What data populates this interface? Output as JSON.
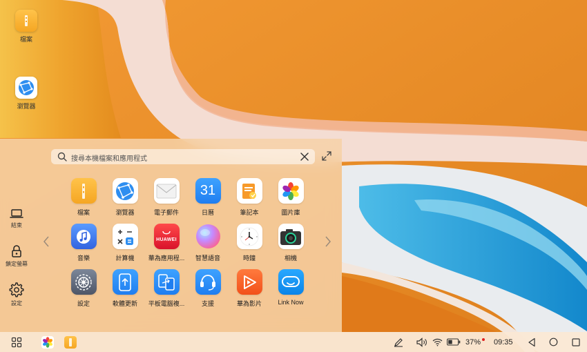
{
  "desktop": {
    "icons": [
      {
        "label": "檔案",
        "icon": "files-icon"
      },
      {
        "label": "瀏覽器",
        "icon": "browser-icon"
      }
    ]
  },
  "launcher": {
    "search": {
      "placeholder": "搜尋本機檔案和應用程式"
    },
    "side": [
      {
        "label": "結束",
        "icon": "laptop-icon"
      },
      {
        "label": "鎖定螢幕",
        "icon": "lock-icon"
      },
      {
        "label": "設定",
        "icon": "gear-icon"
      }
    ],
    "apps": [
      {
        "label": "檔案",
        "icon": "files-icon"
      },
      {
        "label": "瀏覽器",
        "icon": "browser-icon"
      },
      {
        "label": "電子郵件",
        "icon": "mail-icon"
      },
      {
        "label": "日曆",
        "icon": "calendar-icon",
        "badge": "31"
      },
      {
        "label": "筆記本",
        "icon": "notepad-icon"
      },
      {
        "label": "圖片庫",
        "icon": "gallery-icon"
      },
      {
        "label": "音樂",
        "icon": "music-icon"
      },
      {
        "label": "計算機",
        "icon": "calculator-icon"
      },
      {
        "label": "華為應用程...",
        "icon": "appgallery-icon",
        "badge": "HUAWEI"
      },
      {
        "label": "智慧語音",
        "icon": "voice-assistant-icon"
      },
      {
        "label": "時鐘",
        "icon": "clock-icon"
      },
      {
        "label": "相機",
        "icon": "camera-icon"
      },
      {
        "label": "設定",
        "icon": "settings-icon"
      },
      {
        "label": "軟體更新",
        "icon": "software-update-icon"
      },
      {
        "label": "平板電腦複...",
        "icon": "tablet-clone-icon"
      },
      {
        "label": "支援",
        "icon": "support-icon"
      },
      {
        "label": "華為影片",
        "icon": "video-icon"
      },
      {
        "label": "Link Now",
        "icon": "link-now-icon"
      }
    ]
  },
  "taskbar": {
    "battery": "37%",
    "time": "09:35",
    "pinned": [
      "gallery-icon",
      "files-icon"
    ]
  },
  "colors": {
    "orange": "#e8902a",
    "ocean": "#1e9cd8",
    "launcher_bg": "#f6d2a8"
  }
}
